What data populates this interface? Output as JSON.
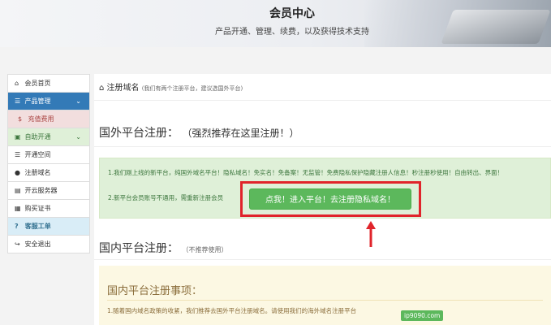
{
  "header": {
    "title": "会员中心",
    "subtitle": "产品开通、管理、续费，以及获得技术支持"
  },
  "sidebar": {
    "items": [
      {
        "label": "会员首页",
        "icon": "home-icon"
      },
      {
        "label": "产品管理",
        "icon": "list-icon",
        "state": "active"
      },
      {
        "label": "充值费用",
        "icon": "dollar-icon"
      },
      {
        "label": "自助开通",
        "icon": "cart-icon"
      },
      {
        "label": "开通空间",
        "icon": "list-icon"
      },
      {
        "label": "注册域名",
        "icon": "globe-icon"
      },
      {
        "label": "开云服务器",
        "icon": "server-icon"
      },
      {
        "label": "购买证书",
        "icon": "certificate-icon"
      },
      {
        "label": "客服工单",
        "icon": "question-icon"
      },
      {
        "label": "安全退出",
        "icon": "logout-icon"
      }
    ]
  },
  "main": {
    "breadcrumb_title": "注册域名",
    "breadcrumb_note": "(我们有两个注册平台，建议选国外平台)",
    "foreign": {
      "title": "国外平台注册：",
      "note": "（强烈推荐在这里注册！）",
      "line1": "1.我们刚上线的新平台，纯国外域名平台！隐私域名！免实名！免备案！无监管！免费隐私保护隐藏注册人信息！秒注册秒使用！自由转出、界面！",
      "line2": "2.新平台会员账号不通用，需重新注册会员",
      "button": "点我！进入平台！去注册隐私域名！"
    },
    "domestic": {
      "title": "国内平台注册：",
      "note": "（不推荐使用）"
    },
    "notice": {
      "title": "国内平台注册事项：",
      "line1": "1.随着国内域名政策的收紧，我们推荐去国外平台注册域名。请使用我们的海外域名注册平台"
    }
  },
  "watermark": "ip9090.com",
  "colors": {
    "primary": "#337ab7",
    "success": "#5cb85c",
    "highlight": "#e0242b"
  }
}
